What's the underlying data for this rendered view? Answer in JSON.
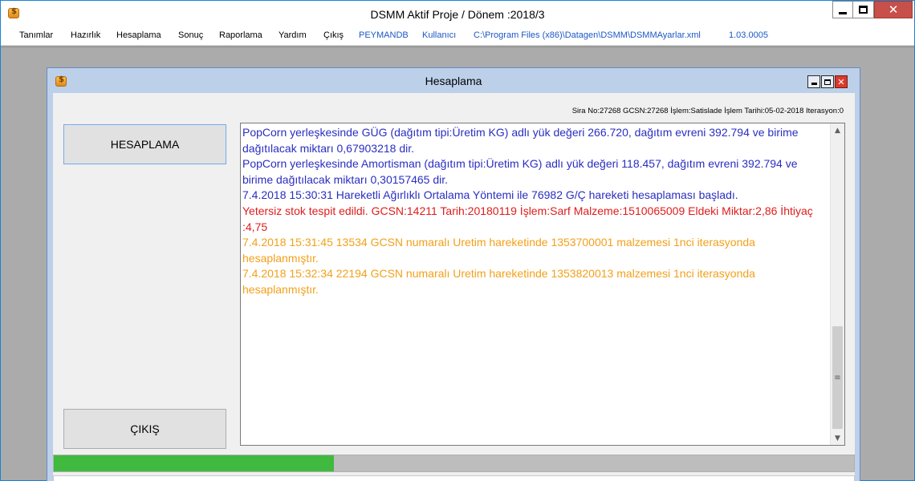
{
  "main_window": {
    "title": "DSMM Aktif Proje / Dönem :2018/3",
    "icon": "app-coin-icon"
  },
  "menu": {
    "items": [
      {
        "label": "Tanımlar"
      },
      {
        "label": "Hazırlık"
      },
      {
        "label": "Hesaplama"
      },
      {
        "label": "Sonuç"
      },
      {
        "label": "Raporlama"
      },
      {
        "label": "Yardım"
      },
      {
        "label": "Çıkış"
      },
      {
        "label": "PEYMANDB"
      },
      {
        "label": "Kullanıcı"
      },
      {
        "label": "C:\\Program Files (x86)\\Datagen\\DSMM\\DSMMAyarlar.xml"
      },
      {
        "label": "1.03.0005"
      }
    ],
    "info_color": "#1c57c6"
  },
  "child_window": {
    "title": "Hesaplama",
    "status_info": "Sira No:27268 GCSN:27268 İşlem:Satislade İşlem Tarihi:05-02-2018 Iterasyon:0",
    "buttons": {
      "hesaplama": "HESAPLAMA",
      "cikis": "ÇIKIŞ"
    },
    "log": [
      {
        "text": "PopCorn yerleşkesinde GÜG (dağıtım tipi:Üretim KG) adlı yük değeri 266.720, dağıtım evreni 392.794 ve birime dağıtılacak miktarı 0,67903218 dir.",
        "color": "#2a2ec0"
      },
      {
        "text": "PopCorn yerleşkesinde Amortisman (dağıtım tipi:Üretim KG) adlı yük değeri 118.457, dağıtım evreni 392.794 ve birime dağıtılacak miktarı 0,30157465 dir.",
        "color": "#2a2ec0"
      },
      {
        "text": "7.4.2018 15:30:31 Hareketli Ağırlıklı Ortalama Yöntemi ile 76982 G/Ç hareketi hesaplaması başladı.",
        "color": "#2a2ec0"
      },
      {
        "text": "Yetersiz stok tespit edildi. GCSN:14211 Tarih:20180119 İşlem:Sarf Malzeme:1510065009 Eldeki Miktar:2,86 İhtiyaç :4,75",
        "color": "#e01b1b"
      },
      {
        "text": "7.4.2018 15:31:45 13534 GCSN numaralı Uretim hareketinde 1353700001 malzemesi 1nci iterasyonda hesaplanmıştır.",
        "color": "#f3a019"
      },
      {
        "text": "7.4.2018 15:32:34 22194 GCSN numaralı Uretim hareketinde 1353820013 malzemesi 1nci iterasyonda hesaplanmıştır.",
        "color": "#f3a019"
      }
    ],
    "progress": 0.35,
    "progress_color": "#3fba3f"
  }
}
